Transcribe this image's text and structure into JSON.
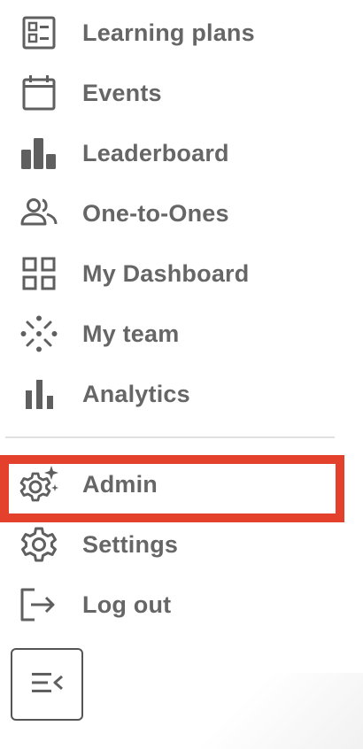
{
  "nav": {
    "items": [
      {
        "id": "learning-plans",
        "label": "Learning plans",
        "icon": "learning-plans-icon"
      },
      {
        "id": "events",
        "label": "Events",
        "icon": "calendar-icon"
      },
      {
        "id": "leaderboard",
        "label": "Leaderboard",
        "icon": "leaderboard-icon"
      },
      {
        "id": "one-to-ones",
        "label": "One-to-Ones",
        "icon": "people-icon"
      },
      {
        "id": "my-dashboard",
        "label": "My Dashboard",
        "icon": "dashboard-grid-icon"
      },
      {
        "id": "my-team",
        "label": "My team",
        "icon": "team-dots-icon"
      },
      {
        "id": "analytics",
        "label": "Analytics",
        "icon": "bar-chart-icon"
      }
    ],
    "admin_items": [
      {
        "id": "admin",
        "label": "Admin",
        "icon": "admin-gear-sparkle-icon",
        "highlighted": true
      },
      {
        "id": "settings",
        "label": "Settings",
        "icon": "settings-gear-icon"
      },
      {
        "id": "log-out",
        "label": "Log out",
        "icon": "logout-icon"
      }
    ],
    "collapse_button": {
      "icon": "collapse-menu-icon"
    }
  },
  "colors": {
    "text": "#666666",
    "icon": "#5f5f5f",
    "highlight_border": "#e3412c",
    "divider": "#e0e0e0"
  }
}
